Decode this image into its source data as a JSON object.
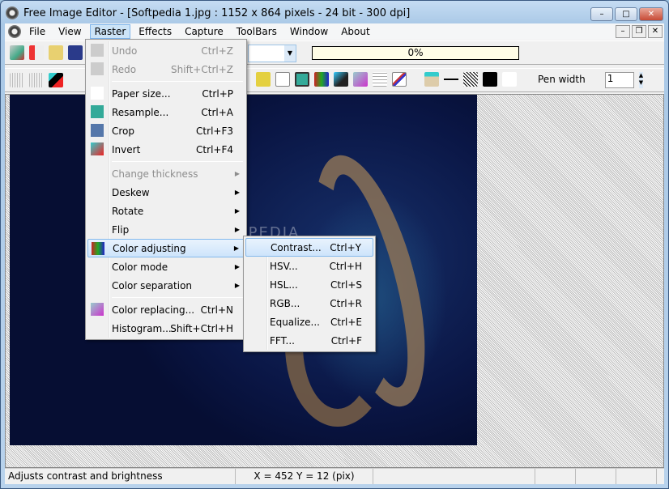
{
  "window": {
    "title": "Free Image Editor - [Softpedia 1.jpg : 1152 x 864 pixels - 24 bit - 300 dpi]",
    "min": "–",
    "max": "□",
    "close": "✕"
  },
  "menubar": [
    "File",
    "View",
    "Raster",
    "Effects",
    "Capture",
    "ToolBars",
    "Window",
    "About"
  ],
  "toolbar": {
    "progress": "0%",
    "pen_width_label": "Pen width",
    "pen_width_value": "1"
  },
  "image": {
    "watermark": "SOFTPEDIA"
  },
  "raster_menu": [
    {
      "label": "Undo",
      "key": "Ctrl+Z",
      "disabled": true
    },
    {
      "label": "Redo",
      "key": "Shift+Ctrl+Z",
      "disabled": true
    },
    {
      "label": "Paper size...",
      "key": "Ctrl+P"
    },
    {
      "label": "Resample...",
      "key": "Ctrl+A"
    },
    {
      "label": "Crop",
      "key": "Ctrl+F3"
    },
    {
      "label": "Invert",
      "key": "Ctrl+F4"
    },
    {
      "label": "Change thickness",
      "disabled": true,
      "submenu": true
    },
    {
      "label": "Deskew",
      "submenu": true
    },
    {
      "label": "Rotate",
      "submenu": true
    },
    {
      "label": "Flip",
      "submenu": true
    },
    {
      "label": "Color adjusting",
      "submenu": true,
      "highlighted": true
    },
    {
      "label": "Color mode",
      "submenu": true
    },
    {
      "label": "Color separation",
      "submenu": true
    },
    {
      "label": "Color replacing...",
      "key": "Ctrl+N"
    },
    {
      "label": "Histogram...",
      "key": "Shift+Ctrl+H"
    }
  ],
  "color_submenu": [
    {
      "label": "Contrast...",
      "key": "Ctrl+Y",
      "highlighted": true
    },
    {
      "label": "HSV...",
      "key": "Ctrl+H"
    },
    {
      "label": "HSL...",
      "key": "Ctrl+S"
    },
    {
      "label": "RGB...",
      "key": "Ctrl+R"
    },
    {
      "label": "Equalize...",
      "key": "Ctrl+E"
    },
    {
      "label": "FFT...",
      "key": "Ctrl+F"
    }
  ],
  "status": {
    "message": "Adjusts contrast and brightness",
    "coords": "X = 452   Y = 12 (pix)"
  }
}
